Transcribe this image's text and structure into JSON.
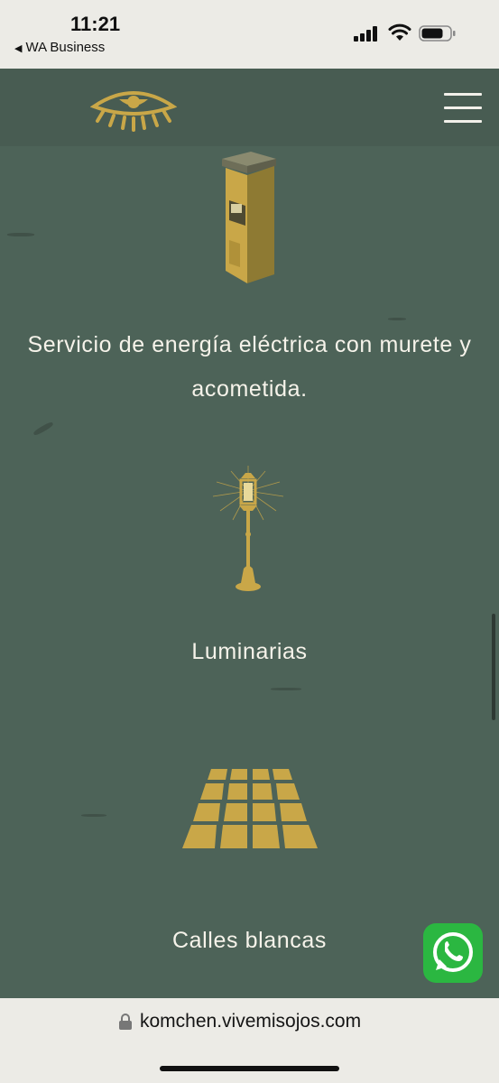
{
  "status_bar": {
    "time": "11:21",
    "back_app": "WA Business",
    "back_icon": "back-triangle-icon"
  },
  "header": {
    "logo_icon": "eye-logo-icon",
    "menu_icon": "hamburger-menu-icon"
  },
  "services": [
    {
      "icon": "electric-meter-post-icon",
      "label": "Servicio de energía eléctrica con murete y acometida."
    },
    {
      "icon": "street-lamp-icon",
      "label": "Luminarias"
    },
    {
      "icon": "paved-street-icon",
      "label": "Calles blancas"
    }
  ],
  "whatsapp": {
    "icon": "whatsapp-icon"
  },
  "browser": {
    "url": "komchen.vivemisojos.com",
    "lock_icon": "lock-icon"
  },
  "colors": {
    "background": "#4d6358",
    "header": "#485c52",
    "gold": "#c9a748",
    "text": "#f6f3ea",
    "whatsapp": "#2bb741"
  }
}
